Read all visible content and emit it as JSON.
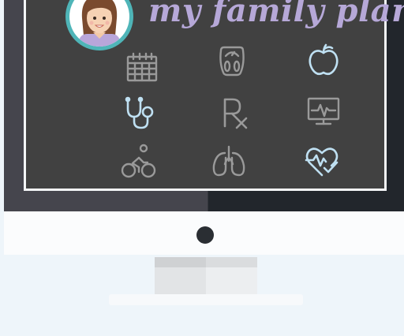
{
  "app": {
    "title": "my family plan"
  },
  "colors": {
    "title": "#b6a8d8",
    "icon_default": "#9a9a9a",
    "icon_active": "#bfe0f2",
    "avatar_ring": "#4fb5b8",
    "screen_bg": "#414141"
  },
  "icons": [
    {
      "name": "calendar-icon",
      "active": false
    },
    {
      "name": "scale-icon",
      "active": false
    },
    {
      "name": "apple-icon",
      "active": true
    },
    {
      "name": "stethoscope-icon",
      "active": true
    },
    {
      "name": "prescription-rx-icon",
      "active": false
    },
    {
      "name": "monitor-pulse-icon",
      "active": false
    },
    {
      "name": "cycling-icon",
      "active": false
    },
    {
      "name": "lungs-icon",
      "active": false
    },
    {
      "name": "heart-check-icon",
      "active": true
    }
  ]
}
